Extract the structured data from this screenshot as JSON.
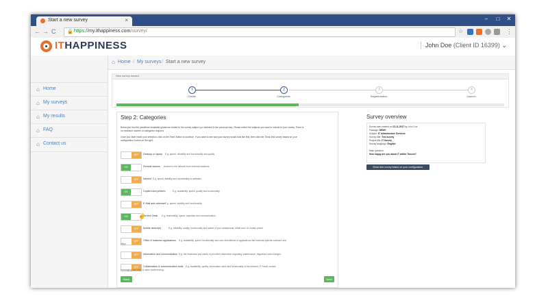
{
  "browser": {
    "tab_title": "Start a new survey",
    "tab_close": "×",
    "url_scheme": "https://",
    "url_host": "my.ithappiness.com",
    "url_path": "/survey/",
    "lock_glyph": "🔒",
    "back_glyph": "←",
    "forward_glyph": "→",
    "reload_glyph": "C",
    "home_glyph": "⌂",
    "win_minimize": "–",
    "win_maximize": "□",
    "win_close": "✕",
    "star_glyph": "☆",
    "menu_glyph": "⋮"
  },
  "header": {
    "logo_it": "IT",
    "logo_rest": "HAPPINESS",
    "user_name": "John Doe",
    "client_id": "(Client ID 16399)",
    "caret": "⌄"
  },
  "sidebar": {
    "items": [
      {
        "label": "Home",
        "icon": "home-icon"
      },
      {
        "label": "My surveys",
        "icon": "home-icon"
      },
      {
        "label": "My results",
        "icon": "home-icon"
      },
      {
        "label": "FAQ",
        "icon": "home-icon"
      },
      {
        "label": "Contact us",
        "icon": "home-icon"
      }
    ],
    "icon_glyph": "⌂"
  },
  "breadcrumb": {
    "home": "Home",
    "sep1": "/",
    "surveys": "My surveys",
    "sep2": "/",
    "current": "Start a new survey"
  },
  "wizard": {
    "header_label": "New survey wizard",
    "steps": [
      {
        "num": "1",
        "label": "Create"
      },
      {
        "num": "2",
        "label": "Categories"
      },
      {
        "num": "3",
        "label": "Segmentation"
      },
      {
        "num": "4",
        "label": "Launch"
      }
    ],
    "progress": 0.47
  },
  "main": {
    "title": "Step 2: Categories",
    "intro1": "Below you find the predefined available questions related to the survey subject you selected in the previous step. Please select the subjects you want to include in your survey. There is",
    "intro2": "no minimum number of categories required.",
    "intro3": "Once you have made your selection, click on the 'Next' button to continue. If you want to see how your survey would look like first, then click the 'Show test survey based on your",
    "intro4": "configuration' button on the right.",
    "on_label": "ON",
    "off_label": "OFF",
    "categories": [
      {
        "name": "Desktop or laptop",
        "desc": "E.g. speed, reliability and functionality and quality.",
        "desc2": "",
        "state": "off"
      },
      {
        "name": "Remote access",
        "desc": "Access to the network from external locations.",
        "desc2": "",
        "state": "on"
      },
      {
        "name": "Internet",
        "desc": "E.g. speed, stability and accessibility to websites.",
        "desc2": "",
        "state": "off"
      },
      {
        "name": "Copiers and printers",
        "desc": "E.g. availability, speed, quality and functionality.",
        "desc2": "",
        "state": "on"
      },
      {
        "name": "E-Mail and calendar",
        "desc": "E.g. speed, stability and functionality.",
        "desc2": "",
        "state": "off"
      },
      {
        "name": "Service Desk",
        "desc": "E.g. reachability, speed, expertise and communication.",
        "desc2": "",
        "state": "on"
      },
      {
        "name": "Mobile device(s)",
        "desc": "E.g. reliability, quality, functionality and speed of your smartphone, tablet and / or mobile phone.",
        "desc2": "",
        "state": "off"
      },
      {
        "name": "Office & business applications",
        "desc": "E.g. availability, speed, functionality and user-friendliness of applications like business specific software and",
        "desc2": "office",
        "state": "off"
      },
      {
        "name": "Information and communication",
        "desc": "E.g. the timeliness and clarity of provided information regarding maintenance, migrations and changes.",
        "desc2": "",
        "state": "off"
      },
      {
        "name": "Collaboration & communication tools",
        "desc": "E.g. availability, quality, information value and functionality of the intranet, IT Portal, instant",
        "desc2": "messaging and voice & video conferencing.",
        "state": "off"
      }
    ],
    "back_label": "Back",
    "next_label": "Next"
  },
  "overview": {
    "title": "Survey overview",
    "created_prefix": "Survey was created on",
    "created_date": "21-11-2017",
    "created_by": "by",
    "created_user": "John Doe",
    "package_label": "Package:",
    "package_value": "DEMO",
    "subject_label": "Subject:",
    "subject_value": "IT Infrastructure Services",
    "survey_title_label": "Survey title:",
    "survey_title_value": "Test survey",
    "project_title_label": "Project title:",
    "project_title_value": "IT Survey",
    "language_label": "Survey language:",
    "language_value": "English",
    "main_question_label": "Main question:",
    "main_question_value": "How happy are you about IT within Tonzon?",
    "show_button": "Show test survey based on your configuration."
  },
  "colors": {
    "tabbar": "#2f4f87",
    "accent_orange": "#e8702a",
    "navy": "#2b3a57",
    "link_blue": "#4a7ebd",
    "on_green": "#5cb85c",
    "off_orange": "#f0ad4e"
  }
}
